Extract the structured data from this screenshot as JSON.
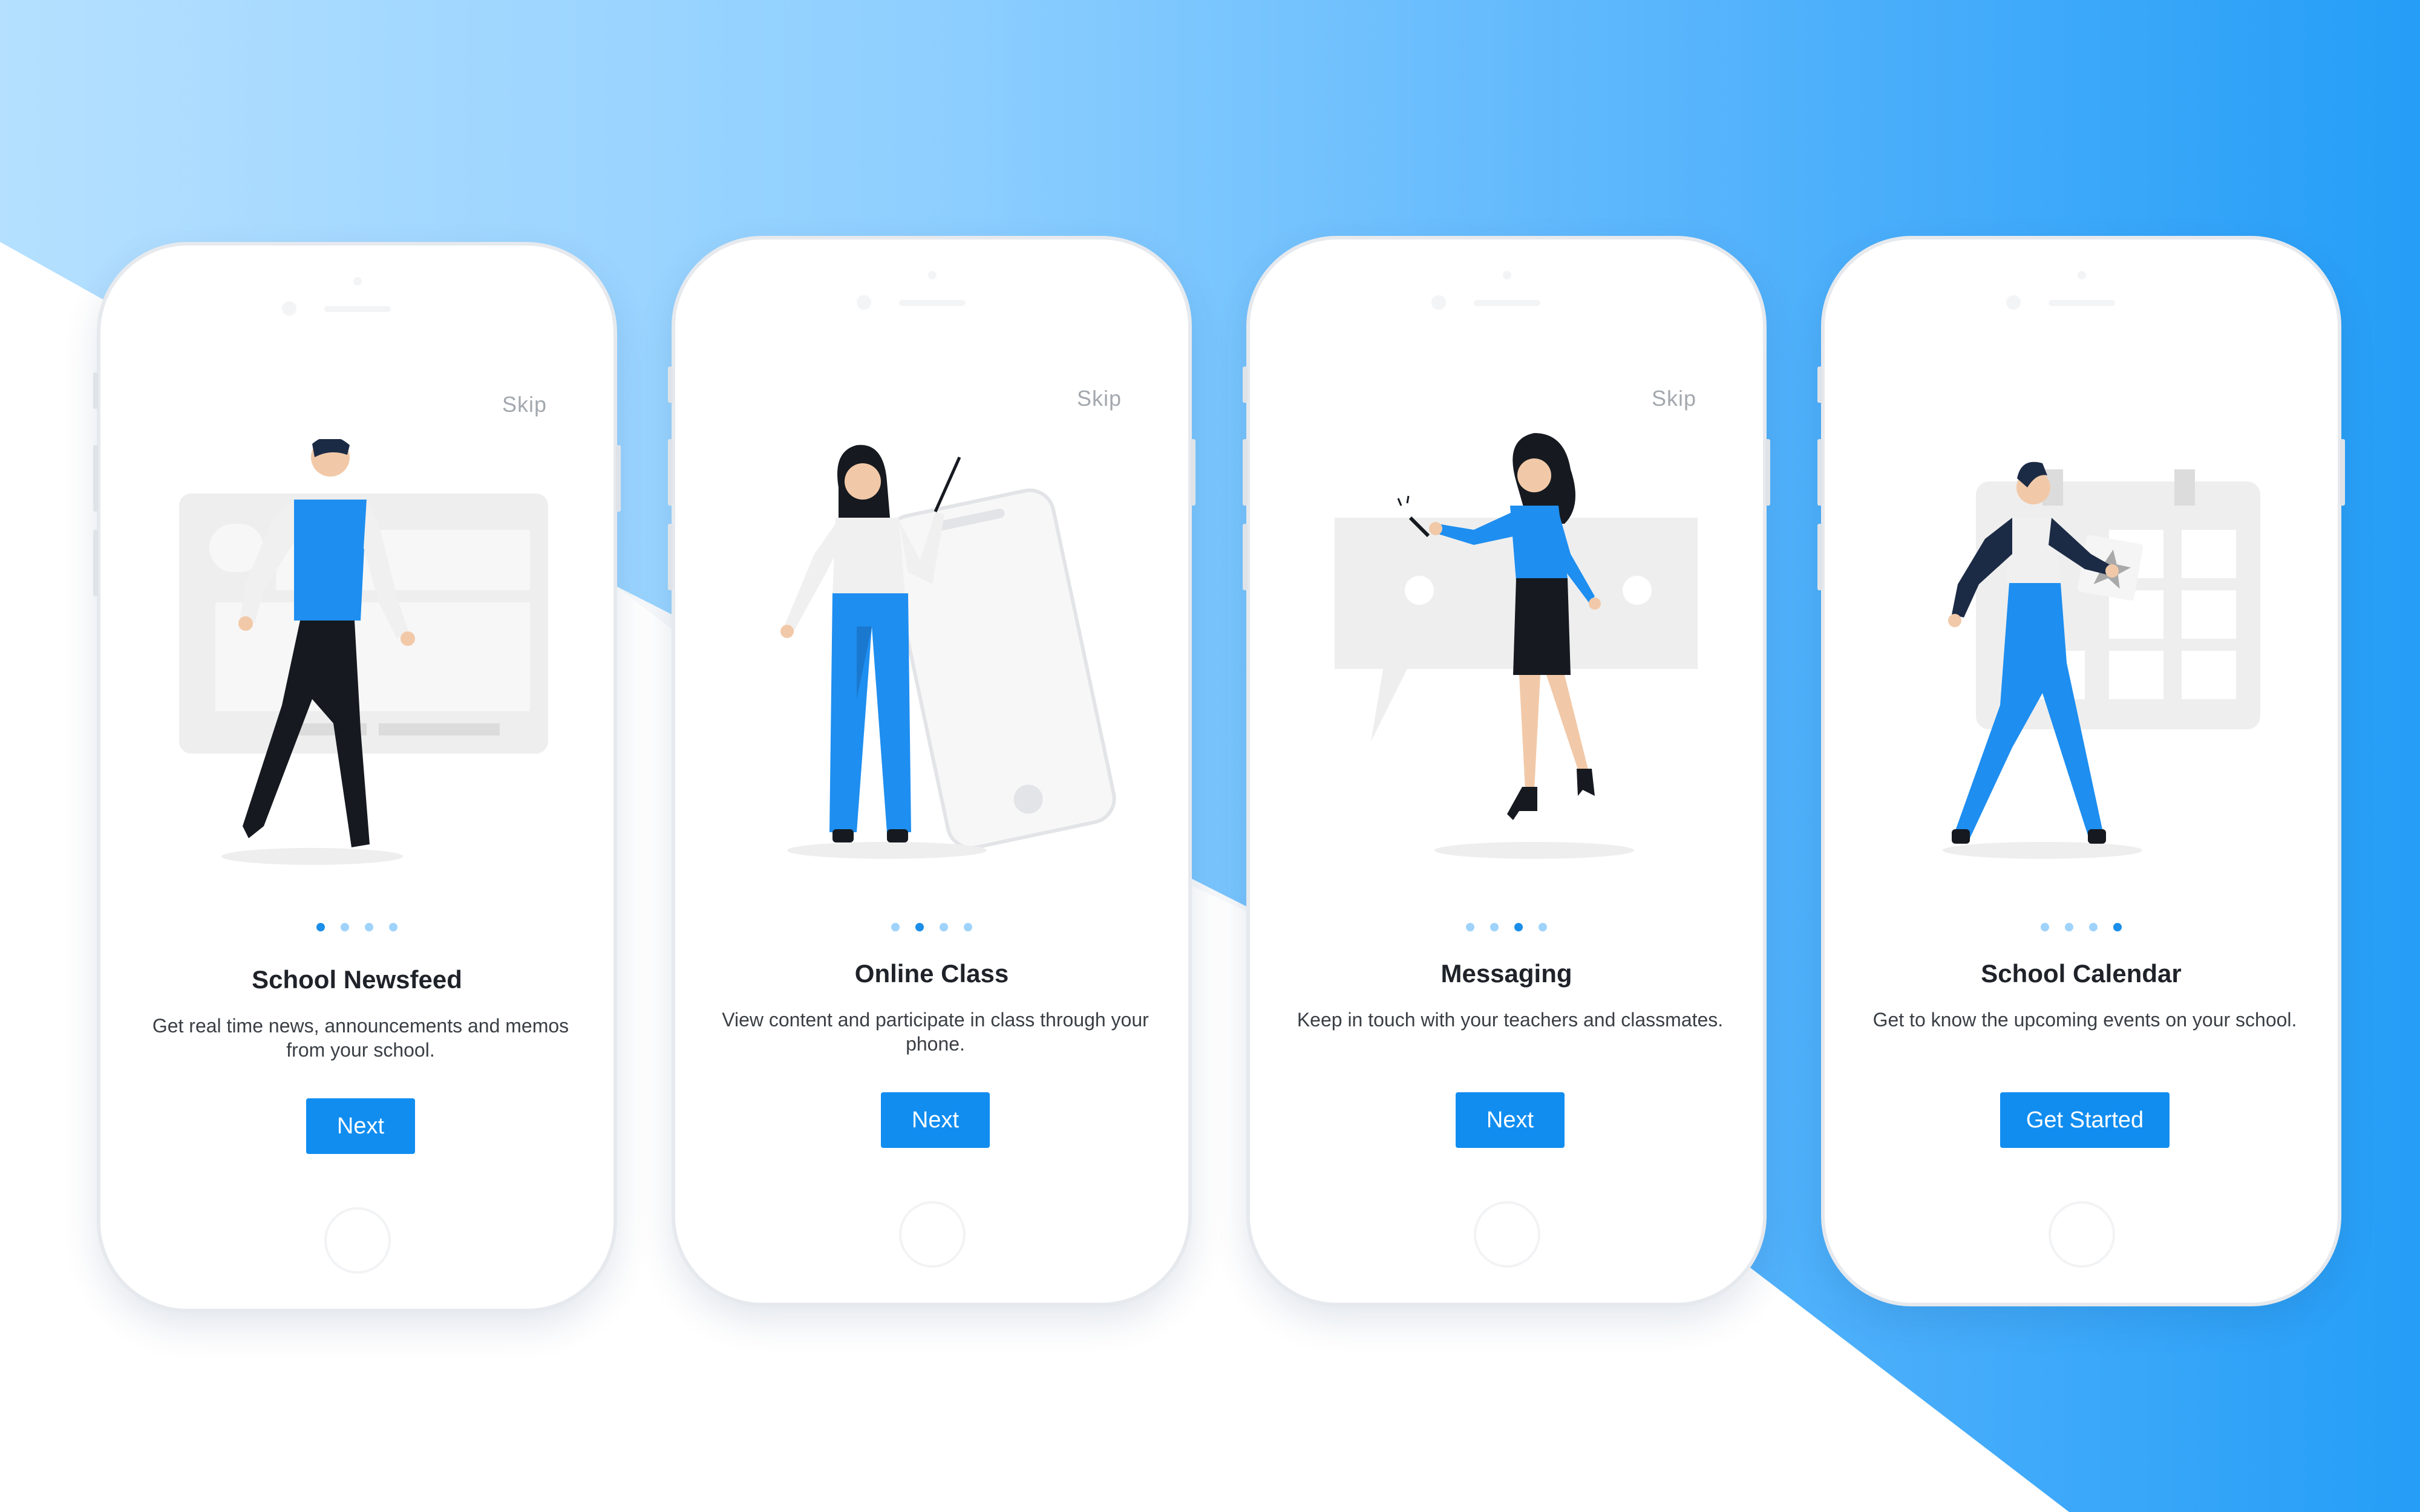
{
  "screens": [
    {
      "skip": "Skip",
      "title": "School Newsfeed",
      "description": "Get real time news, announcements and memos from your school.",
      "button": "Next",
      "active_dot": 0,
      "illustration": "man-walking-with-newsfeed"
    },
    {
      "skip": "Skip",
      "title": "Online Class",
      "description": "View content and participate in class through your phone.",
      "button": "Next",
      "active_dot": 1,
      "illustration": "woman-pointing-at-phone"
    },
    {
      "skip": "Skip",
      "title": "Messaging",
      "description": "Keep in touch with your teachers and classmates.",
      "button": "Next",
      "active_dot": 2,
      "illustration": "woman-texting-with-chat-bubble"
    },
    {
      "skip": "",
      "title": "School Calendar",
      "description": "Get to know the upcoming events on your school.",
      "button": "Get Started",
      "active_dot": 3,
      "illustration": "man-carrying-event-card-calendar"
    }
  ],
  "colors": {
    "accent": "#118df0",
    "dot_active": "#1a8ee8",
    "dot_inactive": "#9fd3fb",
    "figure_blue": "#1e8ef0",
    "figure_dark": "#1c2b45",
    "placeholder_gray": "#eeeeee"
  }
}
